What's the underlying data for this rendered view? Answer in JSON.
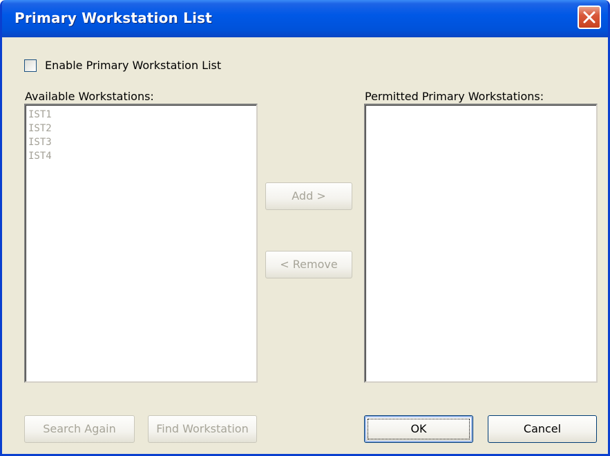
{
  "window": {
    "title": "Primary Workstation List"
  },
  "enable_checkbox": {
    "label": "Enable Primary Workstation List",
    "checked": false
  },
  "available": {
    "label": "Available Workstations:",
    "items": [
      "IST1",
      "IST2",
      "IST3",
      "IST4"
    ]
  },
  "permitted": {
    "label": "Permitted Primary Workstations:",
    "items": []
  },
  "buttons": {
    "add": "Add >",
    "remove": "< Remove",
    "search_again": "Search Again",
    "find_workstation": "Find Workstation",
    "ok": "OK",
    "cancel": "Cancel"
  },
  "icons": {
    "close": "close-icon"
  },
  "colors": {
    "titlebar": "#0058e6",
    "close_button": "#d9583a",
    "dialog_background": "#ece9d8",
    "disabled_text": "#a6a498"
  }
}
